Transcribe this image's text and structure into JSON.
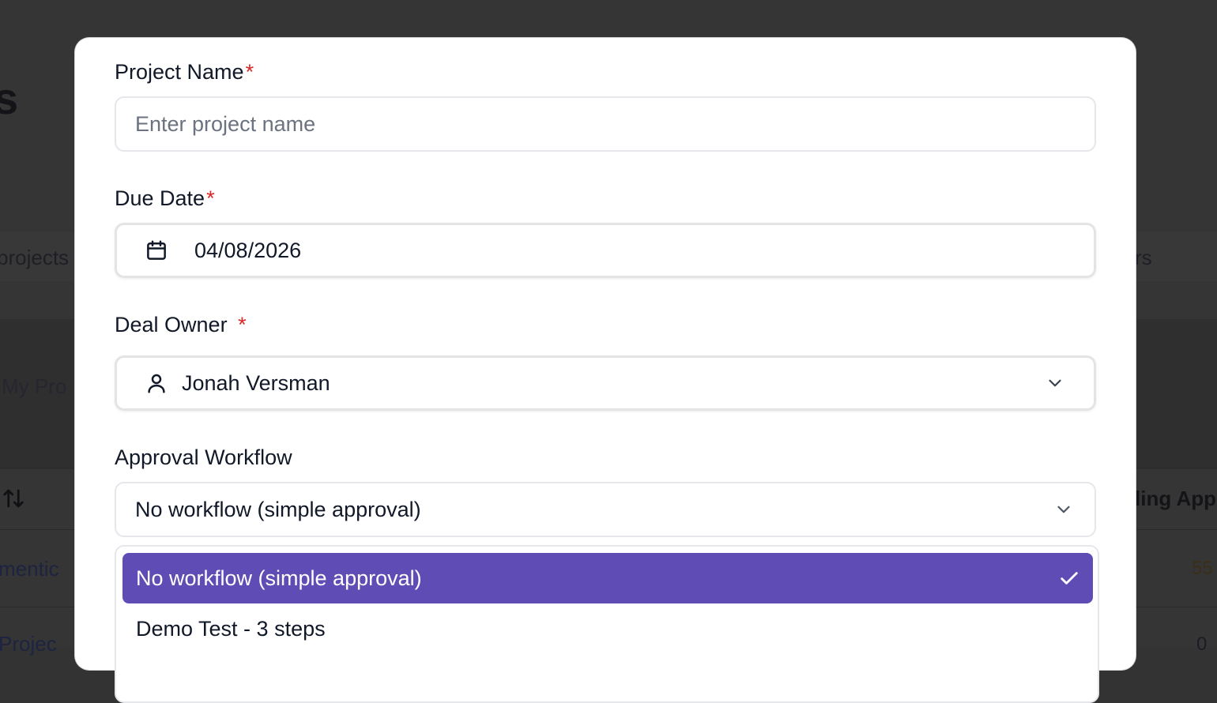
{
  "background": {
    "heading_fragment": "s",
    "tab_left": "projects",
    "tab_right": "rs",
    "filter_fragment": "My Pro",
    "sort_icon": "sort-arrows-icon",
    "column_fragment": "ling App",
    "row1_name": "mentic",
    "row1_value": "55",
    "row2_name": "Projec",
    "row2_value": "0"
  },
  "form": {
    "project_name": {
      "label": "Project Name",
      "required": "*",
      "placeholder": "Enter project name",
      "value": ""
    },
    "due_date": {
      "label": "Due Date",
      "required": "*",
      "value": "04/08/2026",
      "icon": "calendar-icon"
    },
    "deal_owner": {
      "label": "Deal Owner",
      "required": "*",
      "value": "Jonah Versman",
      "icon": "user-icon"
    },
    "approval_workflow": {
      "label": "Approval Workflow",
      "value": "No workflow (simple approval)",
      "options": [
        {
          "label": "No workflow (simple approval)",
          "selected": true
        },
        {
          "label": "Demo Test - 3 steps",
          "selected": false
        }
      ]
    }
  },
  "colors": {
    "accent": "#5f4db5",
    "required": "#dc2626",
    "overlay": "#353535"
  }
}
